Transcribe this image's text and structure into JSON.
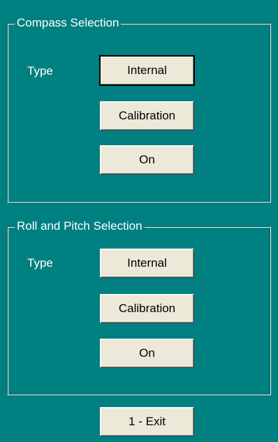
{
  "compass": {
    "title": "Compass Selection",
    "type_label": "Type",
    "type_button": "Internal",
    "calibration_button": "Calibration",
    "power_button": "On"
  },
  "roll_pitch": {
    "title": "Roll and Pitch Selection",
    "type_label": "Type",
    "type_button": "Internal",
    "calibration_button": "Calibration",
    "power_button": "On"
  },
  "footer": {
    "exit_button": "1 - Exit"
  },
  "colors": {
    "background": "#008080",
    "button_face": "#ece9d8",
    "text_light": "#ffffff"
  }
}
